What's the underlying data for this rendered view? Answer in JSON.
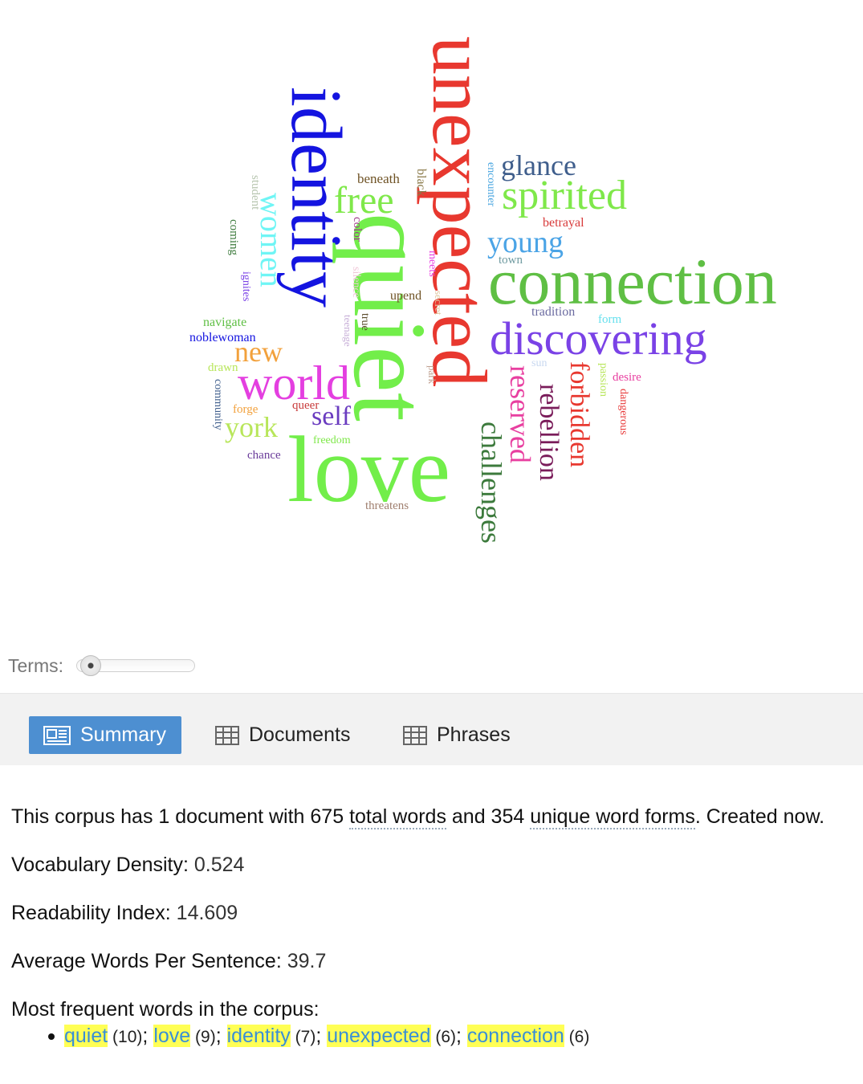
{
  "wordcloud": {
    "words": [
      {
        "text": "unexpected",
        "color": "#e8382f"
      },
      {
        "text": "identity",
        "color": "#1414e0"
      },
      {
        "text": "quiet",
        "color": "#72ee4a"
      },
      {
        "text": "love",
        "color": "#72ee4a"
      },
      {
        "text": "connection",
        "color": "#5fbf44"
      },
      {
        "text": "discovering",
        "color": "#7a42e6"
      },
      {
        "text": "world",
        "color": "#e43fe0"
      },
      {
        "text": "spirited",
        "color": "#7fe84a"
      },
      {
        "text": "free",
        "color": "#7fe84a"
      },
      {
        "text": "glance",
        "color": "#3f5e8c"
      },
      {
        "text": "young",
        "color": "#4ba4e6"
      },
      {
        "text": "women",
        "color": "#6ff5f5"
      },
      {
        "text": "challenges",
        "color": "#3c7a3c"
      },
      {
        "text": "reserved",
        "color": "#e83fa0"
      },
      {
        "text": "rebellion",
        "color": "#7a1c5a"
      },
      {
        "text": "forbidden",
        "color": "#e8382f"
      },
      {
        "text": "new",
        "color": "#f2a13c"
      },
      {
        "text": "self",
        "color": "#6a3cc0"
      },
      {
        "text": "york",
        "color": "#b8e65a"
      },
      {
        "text": "beneath",
        "color": "#6e5224"
      },
      {
        "text": "black",
        "color": "#8a7a4a"
      },
      {
        "text": "encounter",
        "color": "#4aa6e0"
      },
      {
        "text": "betrayal",
        "color": "#d83a3a"
      },
      {
        "text": "town",
        "color": "#6e9aa0"
      },
      {
        "text": "tradition",
        "color": "#6a6aa0"
      },
      {
        "text": "form",
        "color": "#66e0ee"
      },
      {
        "text": "student",
        "color": "#b8c6b0"
      },
      {
        "text": "coming",
        "color": "#3c7a3c"
      },
      {
        "text": "ignites",
        "color": "#7a42e6"
      },
      {
        "text": "color",
        "color": "#a03a8a"
      },
      {
        "text": "silence",
        "color": "#f0c8d8"
      },
      {
        "text": "meets",
        "color": "#e83fe0"
      },
      {
        "text": "upend",
        "color": "#6e5224"
      },
      {
        "text": "secret",
        "color": "#e0c8a0"
      },
      {
        "text": "true",
        "color": "#5a4a2a"
      },
      {
        "text": "teenage",
        "color": "#c8b0d8"
      },
      {
        "text": "navigate",
        "color": "#5fbf44"
      },
      {
        "text": "noblewoman",
        "color": "#1414e0"
      },
      {
        "text": "drawn",
        "color": "#b8e65a"
      },
      {
        "text": "community",
        "color": "#3f5e8c"
      },
      {
        "text": "forge",
        "color": "#f2a13c"
      },
      {
        "text": "queer",
        "color": "#c83a3a"
      },
      {
        "text": "freedom",
        "color": "#7fe84a"
      },
      {
        "text": "chance",
        "color": "#6a3c9a"
      },
      {
        "text": "threatens",
        "color": "#a08070"
      },
      {
        "text": "park",
        "color": "#c0a090"
      },
      {
        "text": "sun",
        "color": "#c8d8f0"
      },
      {
        "text": "passion",
        "color": "#b8e65a"
      },
      {
        "text": "desire",
        "color": "#e83fa0"
      },
      {
        "text": "dangerous",
        "color": "#e83a3a"
      }
    ]
  },
  "terms": {
    "label": "Terms:",
    "value": 0.05
  },
  "tabs": [
    {
      "label": "Summary"
    },
    {
      "label": "Documents"
    },
    {
      "label": "Phrases"
    }
  ],
  "summary": {
    "intro_1": "This corpus has 1 document with 675 ",
    "total_words": "total words",
    "intro_2": " and 354 ",
    "unique_forms": "unique word forms",
    "intro_3": ". Created now.",
    "density_label": "Vocabulary Density:",
    "density_value": " 0.524",
    "readability_label": "Readability Index:",
    "readability_value": " 14.609",
    "avg_label": "Average Words Per Sentence:",
    "avg_value": " 39.7",
    "frequent_label": "Most frequent words in the corpus:",
    "frequent": [
      {
        "word": "quiet",
        "count": " (10)",
        "sep": "; "
      },
      {
        "word": "love",
        "count": " (9)",
        "sep": "; "
      },
      {
        "word": "identity",
        "count": " (7)",
        "sep": "; "
      },
      {
        "word": "unexpected",
        "count": " (6)",
        "sep": "; "
      },
      {
        "word": "connection",
        "count": " (6)",
        "sep": ""
      }
    ]
  }
}
